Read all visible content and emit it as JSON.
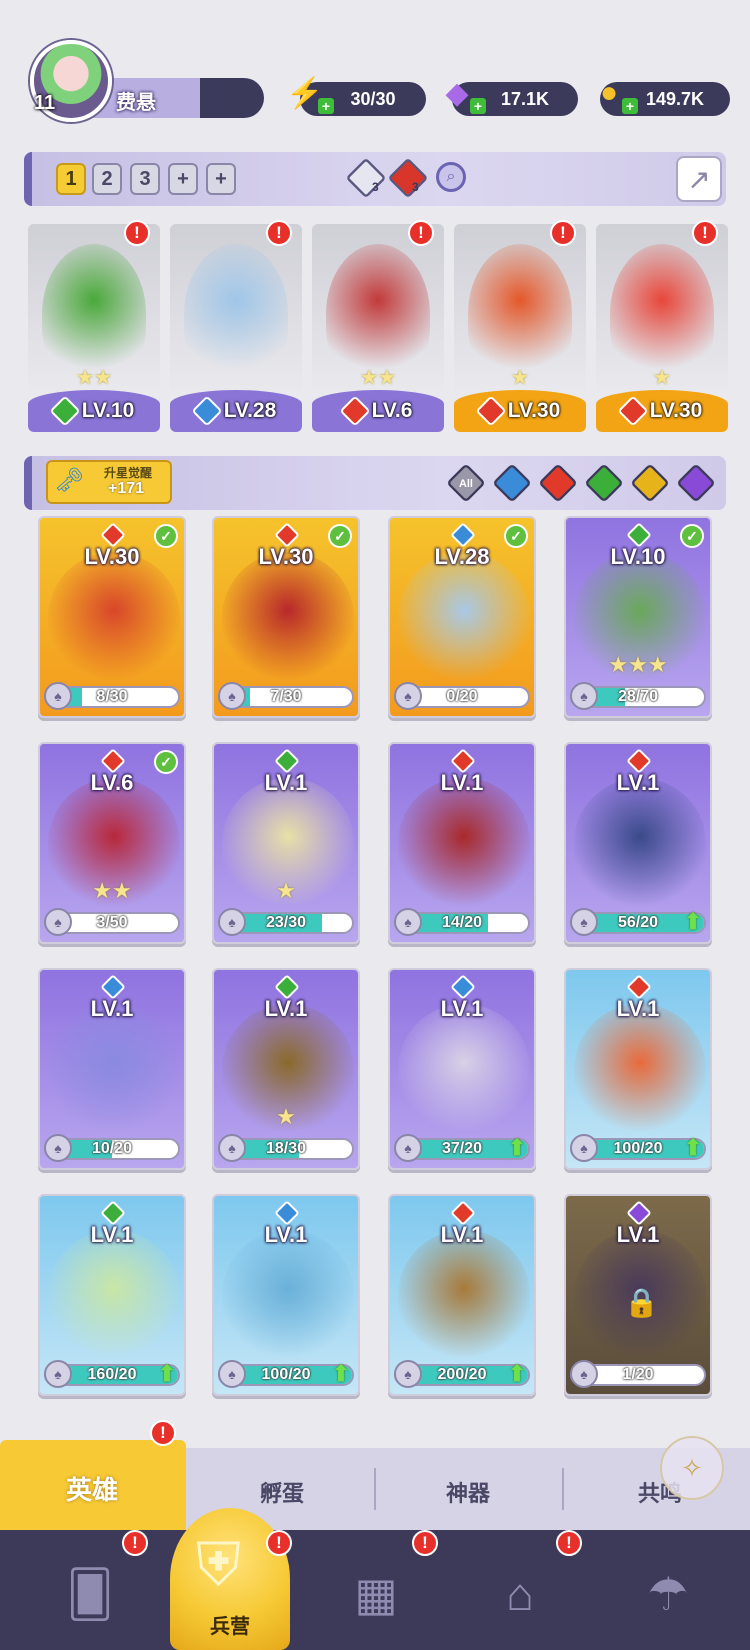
{
  "player": {
    "level": "11",
    "name": "费悬"
  },
  "resources": {
    "energy": {
      "value": "30/30",
      "icon": "lightning-icon"
    },
    "gems": {
      "value": "17.1K",
      "icon": "gem-icon"
    },
    "coins": {
      "value": "149.7K",
      "icon": "coin-icon"
    }
  },
  "team_tabs": [
    "1",
    "2",
    "3",
    "+",
    "+"
  ],
  "team_active": "1",
  "team_summary": {
    "ice_count": "3",
    "fire_count": "3"
  },
  "team_slots": [
    {
      "level": "LV.10",
      "element": "nature",
      "stars": "★★",
      "style": "purple",
      "art": "#4aa83a"
    },
    {
      "level": "LV.28",
      "element": "water",
      "stars": "",
      "style": "purple",
      "art": "#9fc6e8"
    },
    {
      "level": "LV.6",
      "element": "fire",
      "stars": "★★",
      "style": "purple",
      "art": "#c23a3a"
    },
    {
      "level": "LV.30",
      "element": "fire",
      "stars": "★",
      "style": "gold",
      "art": "#e4582a"
    },
    {
      "level": "LV.30",
      "element": "fire",
      "stars": "★",
      "style": "gold",
      "art": "#e8463a"
    }
  ],
  "awaken": {
    "label": "升星觉醒",
    "count": "+171"
  },
  "filters": [
    {
      "label": "All",
      "color": "#9a98a8"
    },
    {
      "label": "",
      "color": "#3a8bd8"
    },
    {
      "label": "",
      "color": "#e23a2a"
    },
    {
      "label": "",
      "color": "#3cae3a"
    },
    {
      "label": "",
      "color": "#e6b41a"
    },
    {
      "label": "",
      "color": "#8a4ad8"
    }
  ],
  "heroes": [
    {
      "level": "LV.30",
      "element": "fire",
      "progress": "8/30",
      "fill": 0.27,
      "bg": "gold",
      "stars": "",
      "check": true,
      "up": false,
      "art": "#d8462a"
    },
    {
      "level": "LV.30",
      "element": "fire",
      "progress": "7/30",
      "fill": 0.23,
      "bg": "gold",
      "stars": "",
      "check": true,
      "up": false,
      "art": "#b8282a"
    },
    {
      "level": "LV.28",
      "element": "water",
      "progress": "0/20",
      "fill": 0,
      "bg": "gold",
      "stars": "",
      "check": true,
      "up": false,
      "art": "#a8c8e6"
    },
    {
      "level": "LV.10",
      "element": "nature",
      "progress": "28/70",
      "fill": 0.4,
      "bg": "purple",
      "stars": "★★★",
      "check": true,
      "up": false,
      "art": "#6aa85a"
    },
    {
      "level": "LV.6",
      "element": "fire",
      "progress": "3/50",
      "fill": 0.06,
      "bg": "purple",
      "stars": "★★",
      "check": true,
      "up": false,
      "art": "#b8283a"
    },
    {
      "level": "LV.1",
      "element": "nature",
      "progress": "23/30",
      "fill": 0.77,
      "bg": "purple",
      "stars": "★",
      "check": false,
      "up": false,
      "art": "#e8e0a6"
    },
    {
      "level": "LV.1",
      "element": "fire",
      "progress": "14/20",
      "fill": 0.7,
      "bg": "purple",
      "stars": "",
      "check": false,
      "up": false,
      "art": "#a82a2a"
    },
    {
      "level": "LV.1",
      "element": "fire",
      "progress": "56/20",
      "fill": 1,
      "bg": "purple",
      "stars": "",
      "check": false,
      "up": true,
      "art": "#3a4a8a"
    },
    {
      "level": "LV.1",
      "element": "water",
      "progress": "10/20",
      "fill": 0.5,
      "bg": "purple",
      "stars": "",
      "check": false,
      "up": false,
      "art": "#8a8ae0"
    },
    {
      "level": "LV.1",
      "element": "nature",
      "progress": "18/30",
      "fill": 0.6,
      "bg": "purple",
      "stars": "★",
      "check": false,
      "up": false,
      "art": "#8a6a2a"
    },
    {
      "level": "LV.1",
      "element": "water",
      "progress": "37/20",
      "fill": 1,
      "bg": "purple",
      "stars": "",
      "check": false,
      "up": true,
      "art": "#d8d0e6"
    },
    {
      "level": "LV.1",
      "element": "fire",
      "progress": "100/20",
      "fill": 1,
      "bg": "blue",
      "stars": "",
      "check": false,
      "up": true,
      "art": "#e86a3a"
    },
    {
      "level": "LV.1",
      "element": "nature",
      "progress": "160/20",
      "fill": 1,
      "bg": "blue",
      "stars": "",
      "check": false,
      "up": true,
      "art": "#c8e6a6"
    },
    {
      "level": "LV.1",
      "element": "water",
      "progress": "100/20",
      "fill": 1,
      "bg": "blue",
      "stars": "",
      "check": false,
      "up": true,
      "art": "#6ab0d8"
    },
    {
      "level": "LV.1",
      "element": "fire",
      "progress": "200/20",
      "fill": 1,
      "bg": "blue",
      "stars": "",
      "check": false,
      "up": true,
      "art": "#a87a3a"
    },
    {
      "level": "LV.1",
      "element": "dark",
      "progress": "1/20",
      "fill": 0.05,
      "bg": "dark",
      "stars": "",
      "check": false,
      "up": false,
      "locked": true,
      "art": "#4a3a5a"
    }
  ],
  "subtabs": [
    "英雄",
    "孵蛋",
    "神器",
    "共鸣"
  ],
  "bottom_nav": {
    "active_label": "兵营",
    "items": [
      "cards-icon",
      "barracks-icon",
      "map-icon",
      "castle-icon",
      "mushroom-icon"
    ]
  },
  "colors": {
    "fire": "#e23a2a",
    "water": "#3a8bd8",
    "nature": "#3cae3a",
    "dark": "#8a4ad8",
    "gold_accent": "#f6c935"
  }
}
